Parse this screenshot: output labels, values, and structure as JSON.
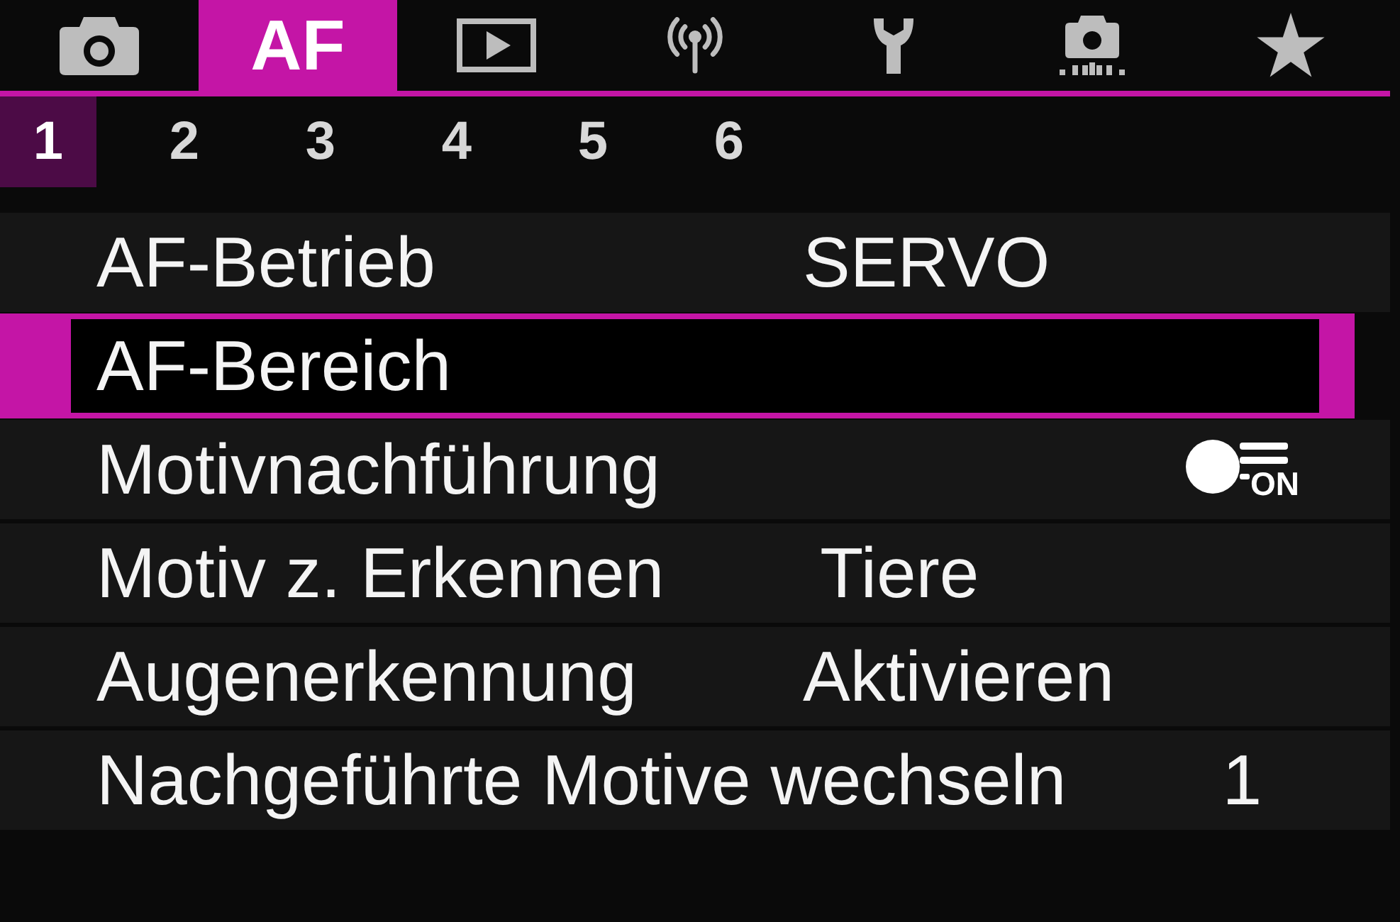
{
  "tabs": [
    {
      "kind": "icon",
      "selected": false
    },
    {
      "kind": "text",
      "label": "AF",
      "selected": true
    },
    {
      "kind": "icon",
      "selected": false
    },
    {
      "kind": "icon",
      "selected": false
    },
    {
      "kind": "icon",
      "selected": false
    },
    {
      "kind": "icon",
      "selected": false
    },
    {
      "kind": "icon",
      "selected": false
    }
  ],
  "pages": [
    {
      "label": "1",
      "selected": true
    },
    {
      "label": "2",
      "selected": false
    },
    {
      "label": "3",
      "selected": false
    },
    {
      "label": "4",
      "selected": false
    },
    {
      "label": "5",
      "selected": false
    },
    {
      "label": "6",
      "selected": false
    }
  ],
  "menu": [
    {
      "label": "AF-Betrieb",
      "kind": "text",
      "value": "SERVO",
      "selected": false
    },
    {
      "label": "AF-Bereich",
      "kind": "text",
      "selected": true
    },
    {
      "label": "Motivnachführung",
      "kind": "icon",
      "value": "ON",
      "selected": false
    },
    {
      "label": "Motiv z. Erkennen",
      "kind": "text",
      "value": "Tiere",
      "selected": false
    },
    {
      "label": "Augenerkennung",
      "kind": "text",
      "value": "Aktivieren",
      "selected": false
    },
    {
      "label": "Nachgeführte Motive wechseln",
      "kind": "text",
      "value": "1",
      "selected": false
    }
  ]
}
